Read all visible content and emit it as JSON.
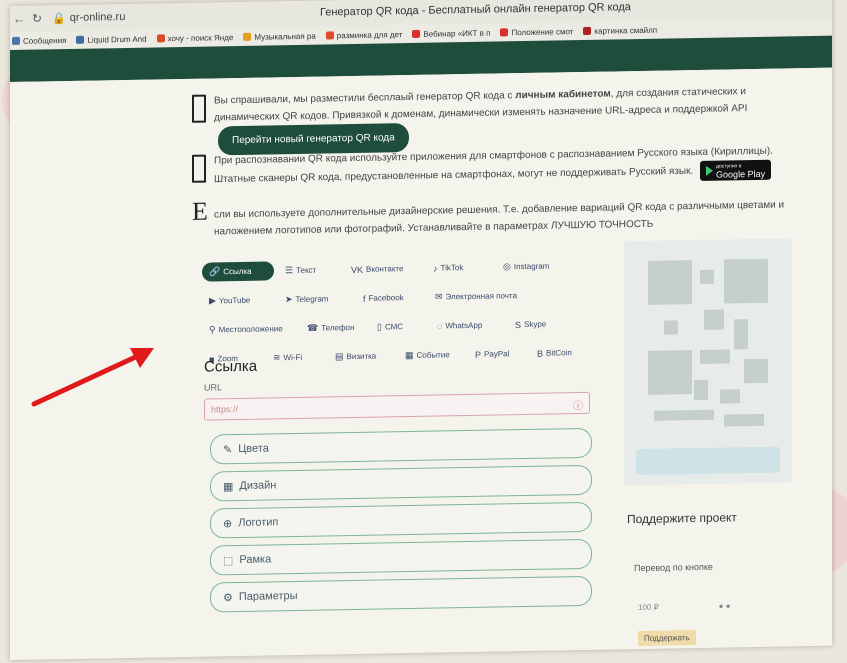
{
  "browser": {
    "url": "qr-online.ru",
    "title": "Генератор QR кода - Бесплатный онлайн генератор QR кода",
    "bookmarks": [
      {
        "label": "Сообщения",
        "color": "#4a76a8"
      },
      {
        "label": "Liquid Drum And",
        "color": "#3a6ea5"
      },
      {
        "label": "хочу - поиск Янде",
        "color": "#e04b2c"
      },
      {
        "label": "Музыкальная ра",
        "color": "#e0a020"
      },
      {
        "label": "разминка для дет",
        "color": "#e04b2c"
      },
      {
        "label": "Вебинар «ИКТ в п",
        "color": "#d9302c"
      },
      {
        "label": "Положение смот",
        "color": "#d9302c"
      },
      {
        "label": "картинка смайлп",
        "color": "#b02020"
      }
    ]
  },
  "info": {
    "block1_pre": "Вы спрашивали, мы разместили бесплаый генератор QR кода с ",
    "block1_bold": "личным кабинетом",
    "block1_post": ", для создания статических и динамических QR кодов. Привязкой к доменам, динамически изменять назначение URL-адреса и поддержкой API",
    "block1_button": "Перейти новый генератор QR кода",
    "block2": "При распознавании QR кода используйте приложения для смартфонов с распознаванием Русского языка (Кириллицы). Штатные сканеры QR кода, предустановленные на смартфонах, могут не поддерживать Русский язык.",
    "gplay_small": "доступно в",
    "gplay_label": "Google Play",
    "block3_initial": "Е",
    "block3": "сли вы используете дополнительные дизайнерские решения. Т.е. добавление вариаций QR кода с различными цветами и наложением логотипов или фотографий. Устанавливайте в параметрах ЛУЧШУЮ ТОЧНОСТЬ"
  },
  "tabs": [
    {
      "label": "Ссылка",
      "icon": "🔗",
      "name": "link"
    },
    {
      "label": "Текст",
      "icon": "☰",
      "name": "text"
    },
    {
      "label": "Вконтакте",
      "icon": "VK",
      "name": "vk"
    },
    {
      "label": "TikTok",
      "icon": "♪",
      "name": "tiktok"
    },
    {
      "label": "Instagram",
      "icon": "◎",
      "name": "instagram"
    },
    {
      "label": "YouTube",
      "icon": "▶",
      "name": "youtube"
    },
    {
      "label": "Telegram",
      "icon": "➤",
      "name": "telegram"
    },
    {
      "label": "Facebook",
      "icon": "f",
      "name": "facebook"
    },
    {
      "label": "Электронная почта",
      "icon": "✉",
      "name": "email"
    },
    {
      "label": "Местоположение",
      "icon": "⚲",
      "name": "location"
    },
    {
      "label": "Телефон",
      "icon": "☎",
      "name": "phone"
    },
    {
      "label": "СМС",
      "icon": "▯",
      "name": "sms"
    },
    {
      "label": "WhatsApp",
      "icon": "◌",
      "name": "whatsapp"
    },
    {
      "label": "Skype",
      "icon": "S",
      "name": "skype"
    },
    {
      "label": "Zoom",
      "icon": "■",
      "name": "zoom"
    },
    {
      "label": "Wi-Fi",
      "icon": "≋",
      "name": "wifi"
    },
    {
      "label": "Визитка",
      "icon": "▤",
      "name": "vcard"
    },
    {
      "label": "Событие",
      "icon": "▦",
      "name": "event"
    },
    {
      "label": "PayPal",
      "icon": "P",
      "name": "paypal"
    },
    {
      "label": "BitCoin",
      "icon": "B",
      "name": "bitcoin"
    }
  ],
  "form": {
    "heading": "Ссылка",
    "url_label": "URL",
    "url_placeholder": "https://",
    "sections": [
      {
        "label": "Цвета",
        "icon": "✎"
      },
      {
        "label": "Дизайн",
        "icon": "▦"
      },
      {
        "label": "Логотип",
        "icon": "⊕"
      },
      {
        "label": "Рамка",
        "icon": "⬚"
      },
      {
        "label": "Параметры",
        "icon": "⚙"
      }
    ]
  },
  "right": {
    "support_title": "Поддержите проект",
    "transfer_label": "Перевод по кнопке",
    "amount": "100 ₽",
    "support_button": "Поддержать"
  }
}
